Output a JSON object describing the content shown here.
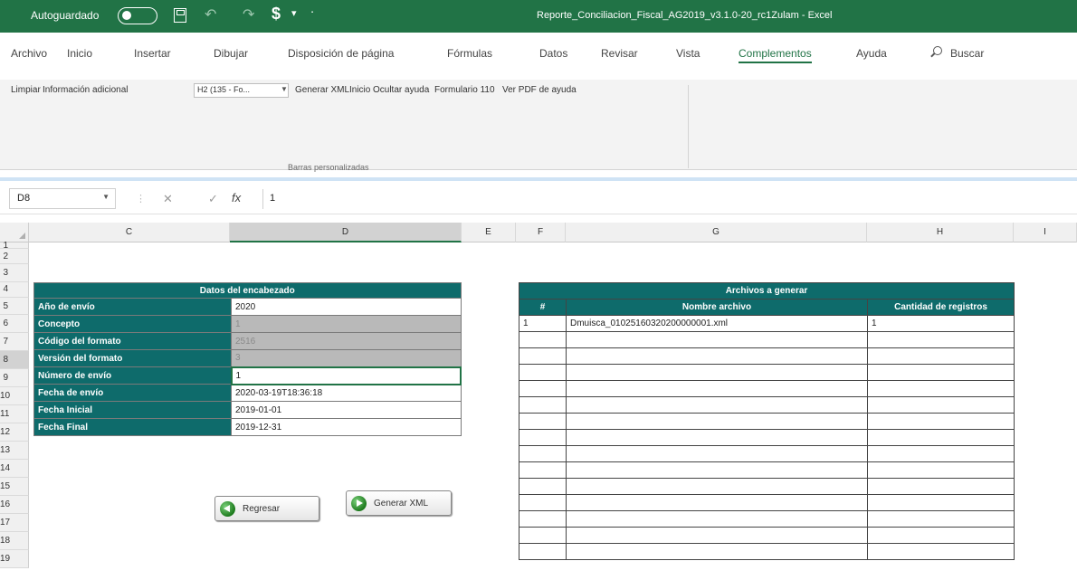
{
  "titlebar": {
    "autosave_label": "Autoguardado",
    "doc_title": "Reporte_Conciliacion_Fiscal_AG2019_v3.1.0-20_rc1Zulam - Excel"
  },
  "ribbon_tabs": [
    "Archivo",
    "Inicio",
    "Insertar",
    "Dibujar",
    "Disposición de página",
    "Fórmulas",
    "Datos",
    "Revisar",
    "Vista",
    "Complementos",
    "Ayuda"
  ],
  "active_tab": "Complementos",
  "search_label": "Buscar",
  "ribbon": {
    "btn_limpiar": "Limpiar",
    "btn_info": "Información adicional",
    "combo_value": "H2 (135 - Fo...",
    "btn_generar": "Generar XML",
    "btn_inicio": "Inicio",
    "btn_ocultar": "Ocultar ayuda",
    "btn_formulario": "Formulario 110",
    "btn_pdf": "Ver PDF de ayuda",
    "group_label": "Barras personalizadas"
  },
  "formula_bar": {
    "name_box": "D8",
    "value": "1"
  },
  "columns": [
    "C",
    "D",
    "E",
    "F",
    "G",
    "H",
    "I"
  ],
  "rows": [
    "1",
    "2",
    "3",
    "4",
    "5",
    "6",
    "7",
    "8",
    "9",
    "10",
    "11",
    "12",
    "13",
    "14",
    "15",
    "16",
    "17",
    "18",
    "19"
  ],
  "header_data": {
    "title": "Datos del encabezado",
    "rows": [
      {
        "label": "Año de envío",
        "value": "2020"
      },
      {
        "label": "Concepto",
        "value": "1"
      },
      {
        "label": "Código del formato",
        "value": "2516"
      },
      {
        "label": "Versión del formato",
        "value": "3"
      },
      {
        "label": "Número de envío",
        "value": "1"
      },
      {
        "label": "Fecha de envío",
        "value": "2020-03-19T18:36:18"
      },
      {
        "label": "Fecha Inicial",
        "value": "2019-01-01"
      },
      {
        "label": "Fecha Final",
        "value": "2019-12-31"
      }
    ]
  },
  "buttons": {
    "regresar": "Regresar",
    "generar_xml": "Generar XML"
  },
  "files_table": {
    "title": "Archivos a generar",
    "headers": [
      "#",
      "Nombre archivo",
      "Cantidad de registros"
    ],
    "rows": [
      {
        "num": "1",
        "name": "Dmuisca_01025160320200000001.xml",
        "count": "1"
      }
    ]
  }
}
